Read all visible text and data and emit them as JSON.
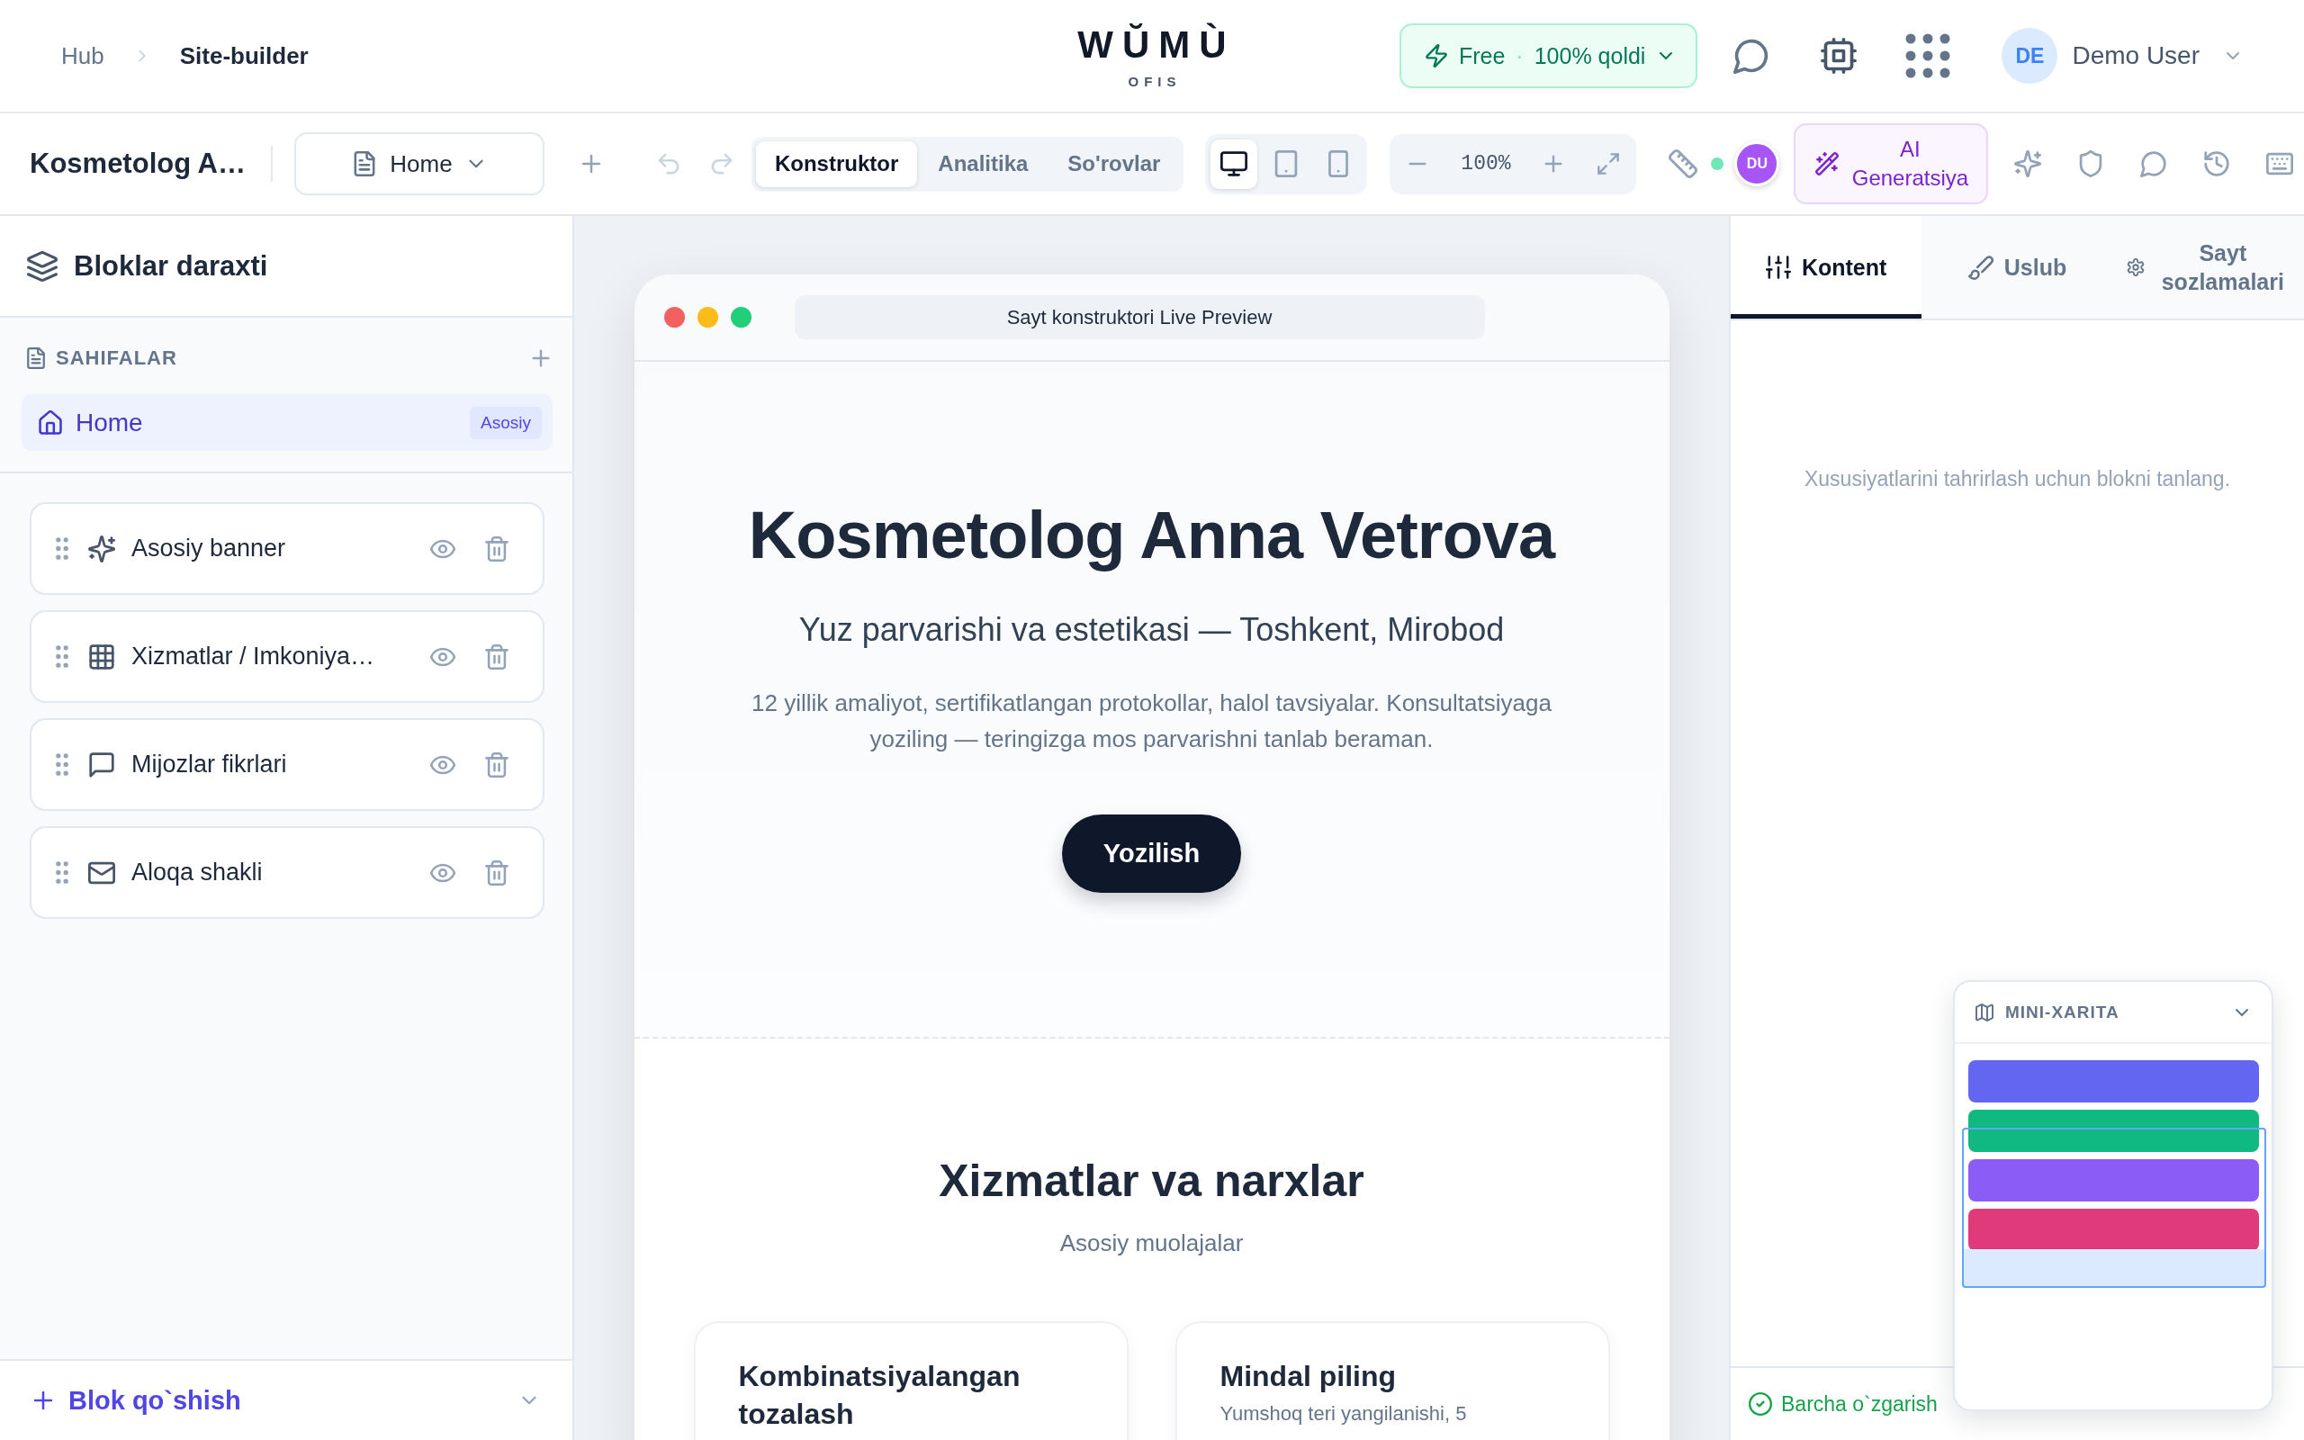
{
  "header": {
    "breadcrumb": [
      {
        "label": "Hub",
        "current": false
      },
      {
        "label": "Site-builder",
        "current": true
      }
    ],
    "logo": {
      "wordmark": "WŬMÙ",
      "tagline": "OFIS"
    },
    "plan": {
      "label": "Free",
      "separator": "·",
      "quota": "100% qoldi"
    },
    "user": {
      "initials": "DE",
      "name": "Demo User"
    }
  },
  "toolbar": {
    "project_title": "Kosmetolog A…",
    "page_select": {
      "value": "Home"
    },
    "modes": [
      {
        "label": "Konstruktor",
        "selected": true
      },
      {
        "label": "Analitika",
        "selected": false
      },
      {
        "label": "So'rovlar",
        "selected": false
      }
    ],
    "devices": [
      {
        "kind": "desktop",
        "selected": true
      },
      {
        "kind": "tablet",
        "selected": false
      },
      {
        "kind": "mobile",
        "selected": false
      }
    ],
    "zoom": "100%",
    "collaborator": {
      "initials": "DU",
      "online": true
    },
    "ai_button": "AI Generatsiya"
  },
  "sidebar": {
    "title": "Bloklar daraxti",
    "pages_label": "SAHIFALAR",
    "pages": [
      {
        "name": "Home",
        "badge": "Asosiy",
        "selected": true
      }
    ],
    "blocks": [
      {
        "kind": "hero",
        "name": "Asosiy banner"
      },
      {
        "kind": "grid",
        "name": "Xizmatlar / Imkoniya…"
      },
      {
        "kind": "testimonials",
        "name": "Mijozlar fikrlari"
      },
      {
        "kind": "contact",
        "name": "Aloqa shakli"
      }
    ],
    "add_block": "Blok qo`shish"
  },
  "preview": {
    "address": "Sayt konstruktori Live Preview",
    "hero": {
      "title": "Kosmetolog Anna Vetrova",
      "subtitle": "Yuz parvarishi va estetikasi — Toshkent, Mirobod",
      "text": "12 yillik amaliyot, sertifikatlangan protokollar, halol tavsiyalar. Konsultatsiyaga yoziling — teringizga mos parvarishni tanlab beraman.",
      "button": "Yozilish"
    },
    "services": {
      "title": "Xizmatlar va narxlar",
      "subtitle": "Asosiy muolajalar",
      "cards": [
        {
          "title": "Kombinatsiyalangan tozalash"
        },
        {
          "title": "Mindal piling",
          "text": "Yumshoq teri yangilanishi, 5"
        }
      ]
    }
  },
  "inspector": {
    "tabs": [
      {
        "kind": "content",
        "label": "Kontent",
        "selected": true
      },
      {
        "kind": "style",
        "label": "Uslub",
        "selected": false
      },
      {
        "kind": "settings",
        "label": "Sayt sozlamalari",
        "selected": false
      }
    ],
    "empty_message": "Xususiyatlarini tahrirlash uchun blokni tanlang.",
    "status": "Barcha o`zgarish"
  },
  "minimap": {
    "title": "MINI-XARITA",
    "blocks": [
      {
        "color": "#6366f1"
      },
      {
        "color": "#10b981"
      },
      {
        "color": "#8b5cf6"
      },
      {
        "color": "#e03a7a"
      }
    ]
  }
}
